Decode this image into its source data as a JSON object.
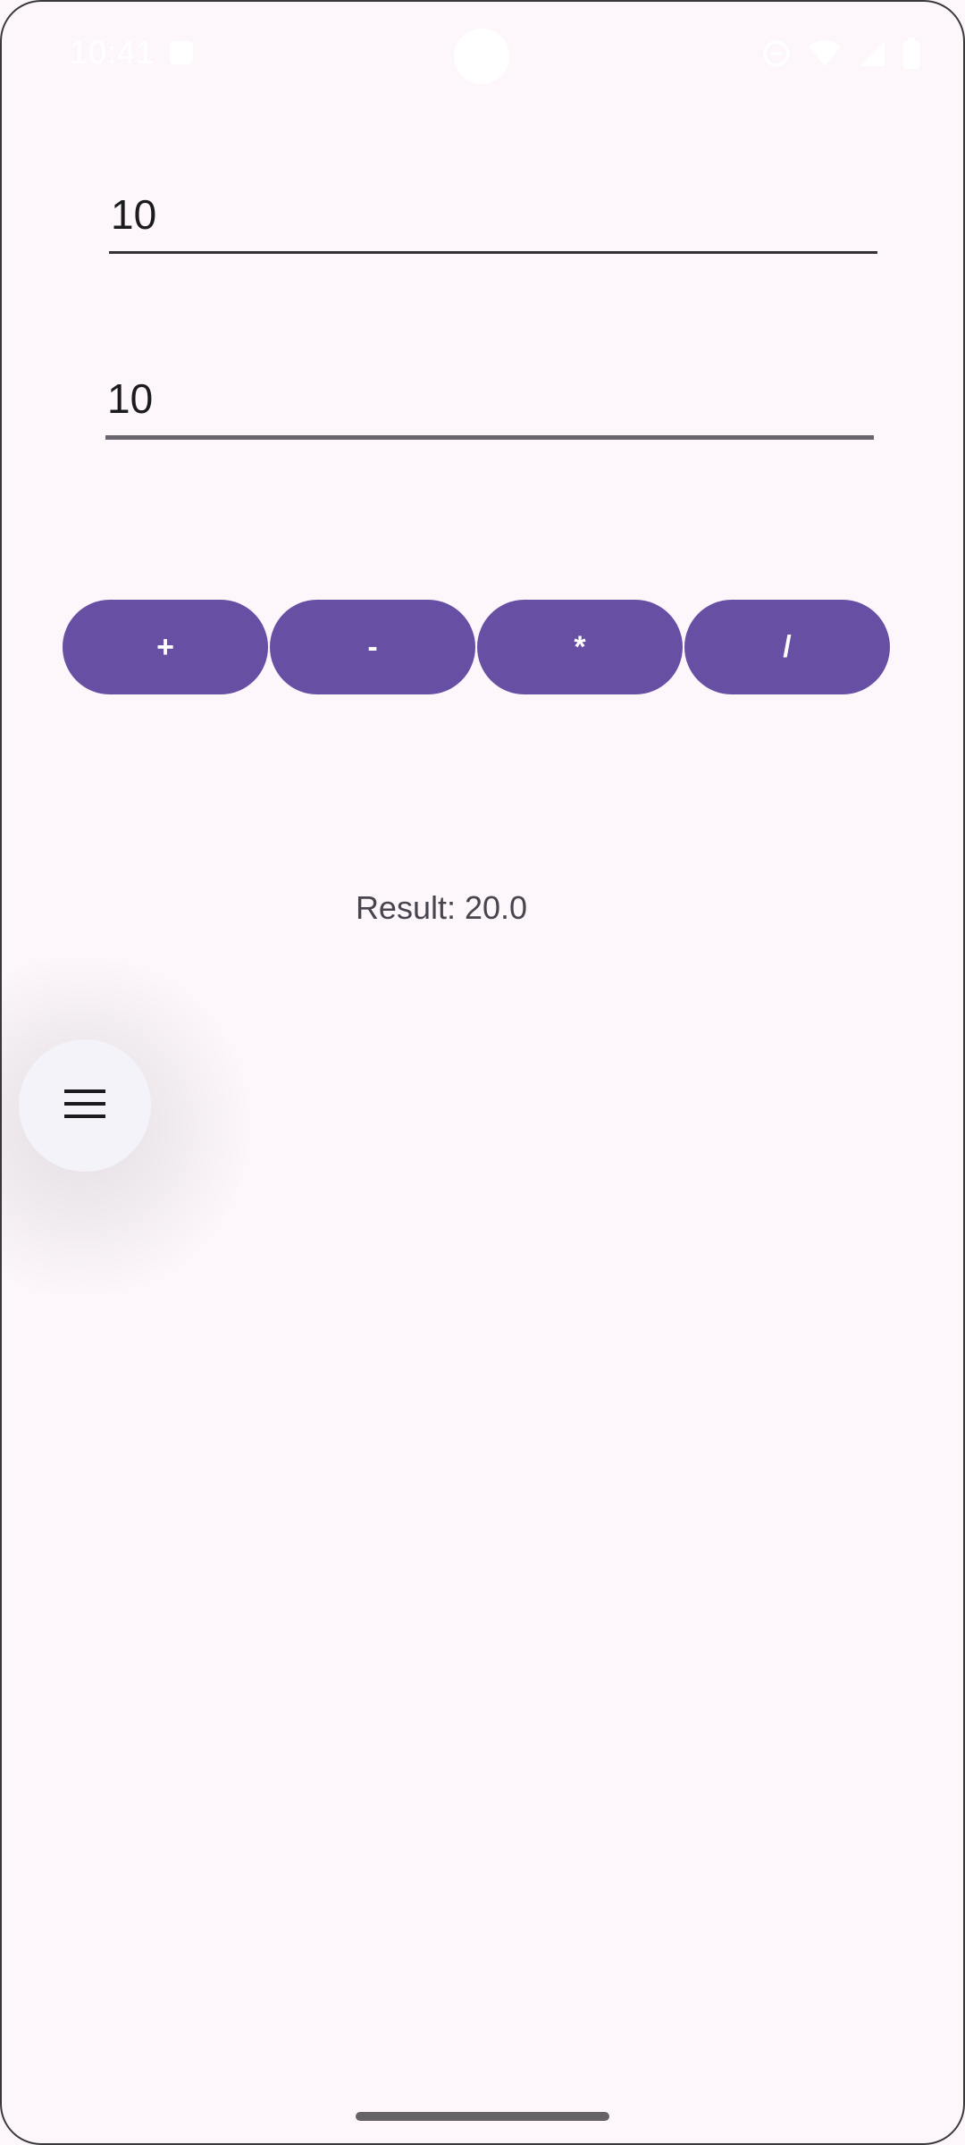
{
  "status_bar": {
    "time": "10:41",
    "icons": [
      "notification-icon",
      "data-saver-icon",
      "wifi-icon",
      "signal-icon",
      "battery-icon"
    ]
  },
  "form": {
    "first_number": "10",
    "second_number": "10"
  },
  "operators": {
    "add": "+",
    "subtract": "-",
    "multiply": "*",
    "divide": "/"
  },
  "result_text": "Result: 20.0",
  "fab": {
    "icon": "menu-icon"
  },
  "colors": {
    "background": "#fdf7fc",
    "button": "#6750a4",
    "button_text": "#ffffff",
    "fab_background": "#f4f3f9"
  }
}
